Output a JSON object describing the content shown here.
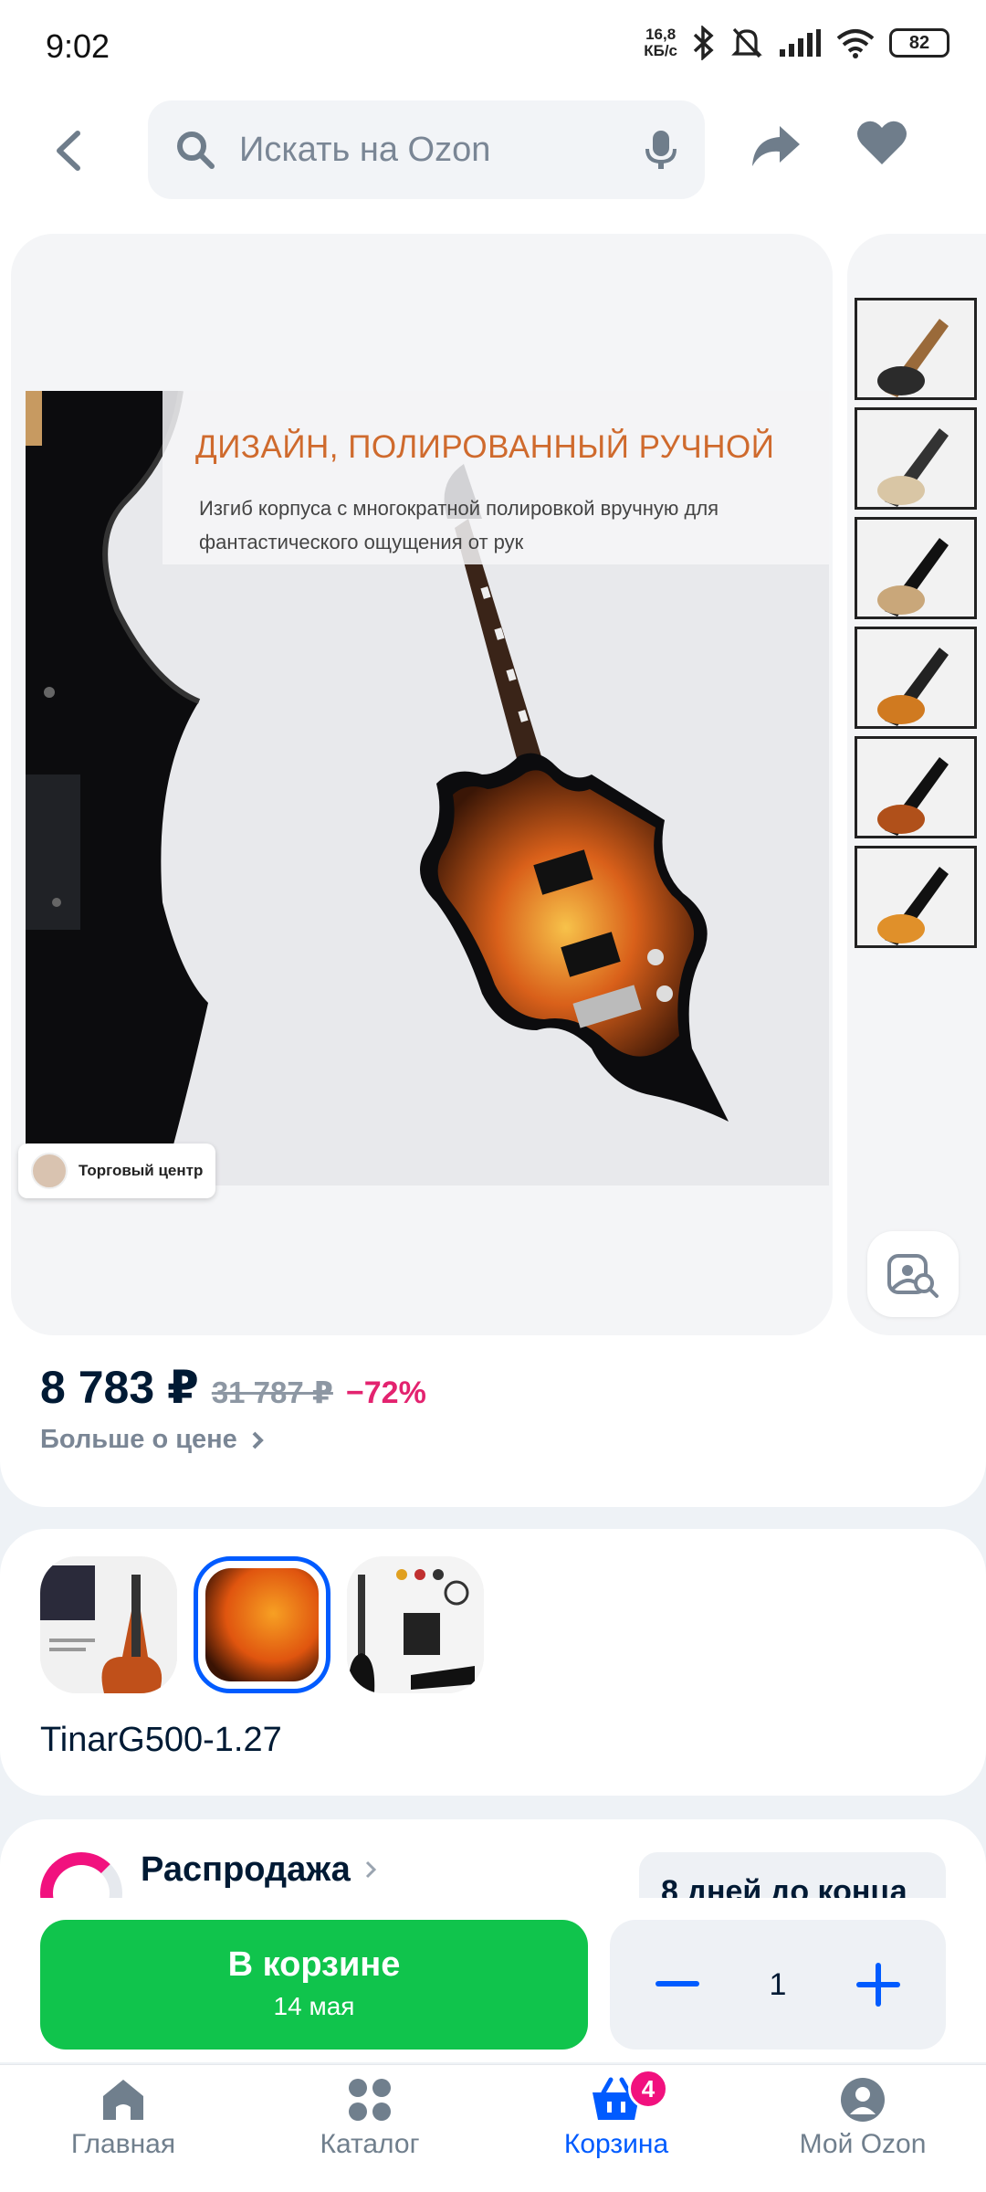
{
  "status_bar": {
    "time": "9:02",
    "speed_value": "16,8",
    "speed_unit": "КБ/с",
    "battery": "82"
  },
  "header": {
    "search_placeholder": "Искать на Ozon"
  },
  "gallery": {
    "banner_title": "ДИЗАЙН, ПОЛИРОВАННЫЙ РУЧНОЙ",
    "banner_text": "Изгиб корпуса с многократной полировкой вручную для фантастического ощущения от рук",
    "seller_chip": "Торговый центр",
    "thumbnail_count": 6
  },
  "price": {
    "current": "8 783 ₽",
    "old": "31 787 ₽",
    "discount": "−72%",
    "more_link": "Больше о цене"
  },
  "variants": {
    "model": "TinarG500-1.27"
  },
  "sale": {
    "title": "Распродажа",
    "days_left": "8 дней до конца"
  },
  "action": {
    "cart_label": "В корзине",
    "cart_date": "14 мая",
    "quantity": "1"
  },
  "nav": {
    "items": [
      {
        "label": "Главная"
      },
      {
        "label": "Каталог"
      },
      {
        "label": "Корзина",
        "badge": "4"
      },
      {
        "label": "Мой Ozon"
      }
    ]
  },
  "colors": {
    "accent": "#005bff",
    "cart_green": "#10c44c",
    "discount_pink": "#e3236f"
  }
}
